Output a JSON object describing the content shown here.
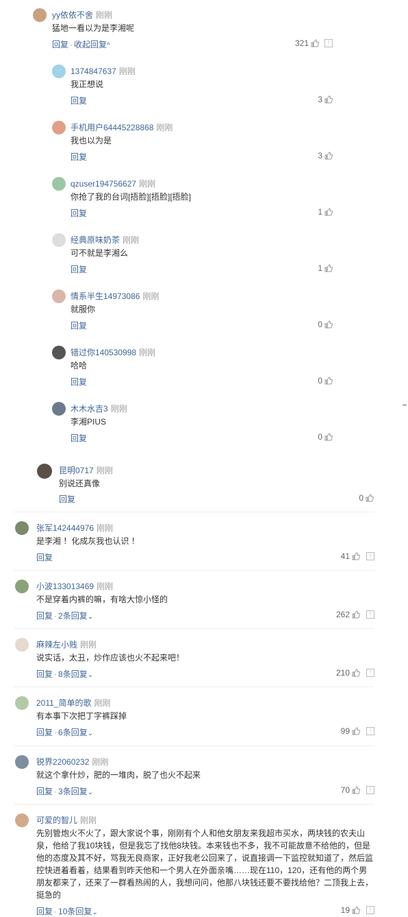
{
  "thread": {
    "main": {
      "user": "yy依依不舍",
      "time": "刚刚",
      "text": "猛地一看以为是李湘呢",
      "reply": "回复",
      "collapse": "收起回复",
      "likes": "321"
    },
    "replies": [
      {
        "user": "1374847637",
        "time": "刚刚",
        "text": "我正想说",
        "reply": "回复",
        "likes": "3",
        "avatar_color": "#9fd3e6"
      },
      {
        "user": "手机用户64445228868",
        "time": "刚刚",
        "text": "我也以为是",
        "reply": "回复",
        "likes": "3",
        "avatar_color": "#e0a088"
      },
      {
        "user": "qzuser194756627",
        "time": "刚刚",
        "text": "你抢了我的台词[捂脸][捂脸][捂脸]",
        "reply": "回复",
        "likes": "1",
        "avatar_color": "#9bc7a4"
      },
      {
        "user": "经典原味奶茶",
        "time": "刚刚",
        "text": "可不就是李湘么",
        "reply": "回复",
        "likes": "1",
        "avatar_color": "#dddddd"
      },
      {
        "user": "情系半生14973086",
        "time": "刚刚",
        "text": "就服你",
        "reply": "回复",
        "likes": "0",
        "avatar_color": "#d9b7a8"
      },
      {
        "user": "错过你140530998",
        "time": "刚刚",
        "text": "哈哈",
        "reply": "回复",
        "likes": "0",
        "avatar_color": "#555555"
      },
      {
        "user": "木木水吉3",
        "time": "刚刚",
        "text": "李湘PIUS",
        "reply": "回复",
        "likes": "0",
        "avatar_color": "#6d7a8e"
      }
    ]
  },
  "mid_comment": {
    "user": "昆明0717",
    "time": "刚刚",
    "text": "别说还真像",
    "reply": "回复",
    "likes": "0"
  },
  "comments": [
    {
      "user": "张军142444976",
      "time": "刚刚",
      "text": "是李湘 ！化成灰我也认识 ！",
      "reply": "回复",
      "more": "",
      "likes": "41",
      "avatar_color": "#7a8a6a"
    },
    {
      "user": "小波133013469",
      "time": "刚刚",
      "text": "不是穿着内裤的嘛，有啥大惊小怪的",
      "reply": "回复",
      "more": "2条回复",
      "likes": "262",
      "avatar_color": "#8aa27a"
    },
    {
      "user": "麻辣左小贱",
      "time": "刚刚",
      "text": "说实话，太丑，炒作应该也火不起来吧！",
      "reply": "回复",
      "more": "8条回复",
      "likes": "210",
      "avatar_color": "#e6d9d0"
    },
    {
      "user": "2011_简单的歌",
      "time": "刚刚",
      "text": "有本事下次把丁字裤踩掉",
      "reply": "回复",
      "more": "6条回复",
      "likes": "99",
      "avatar_color": "#b4c9a8"
    },
    {
      "user": "锐界22060232",
      "time": "刚刚",
      "text": "就这个拿什炒，肥的一堆肉，脱了也火不起来",
      "reply": "回复",
      "more": "3条回复",
      "likes": "70",
      "avatar_color": "#7d8ea0"
    },
    {
      "user": "可爱的智儿",
      "time": "刚刚",
      "text": "先别管炮火不火了，跟大家说个事，刚刚有个人和他女朋友来我超市买水，两块钱的农夫山泉，他给了我10块钱，但是我忘了找他8块钱。本来钱也不多，我不可能故意不给他的，但是他的态度及其不好，骂我无良商家，正好我老公回来了，说直接调一下监控就知道了，然后监控快进着看着，结果看到昨天他和一个男人在外面亲嘴……现在110，120，还有他的两个男朋友都来了，还来了一群看热闹的人，我想问问，他那八块钱还要不要找给他？二顶我上去，挺急的",
      "reply": "回复",
      "more": "10条回复",
      "likes": "19",
      "avatar_color": "#d2a98a"
    }
  ],
  "icons": {
    "like": "thumbs-up-icon",
    "report": "report-icon"
  }
}
